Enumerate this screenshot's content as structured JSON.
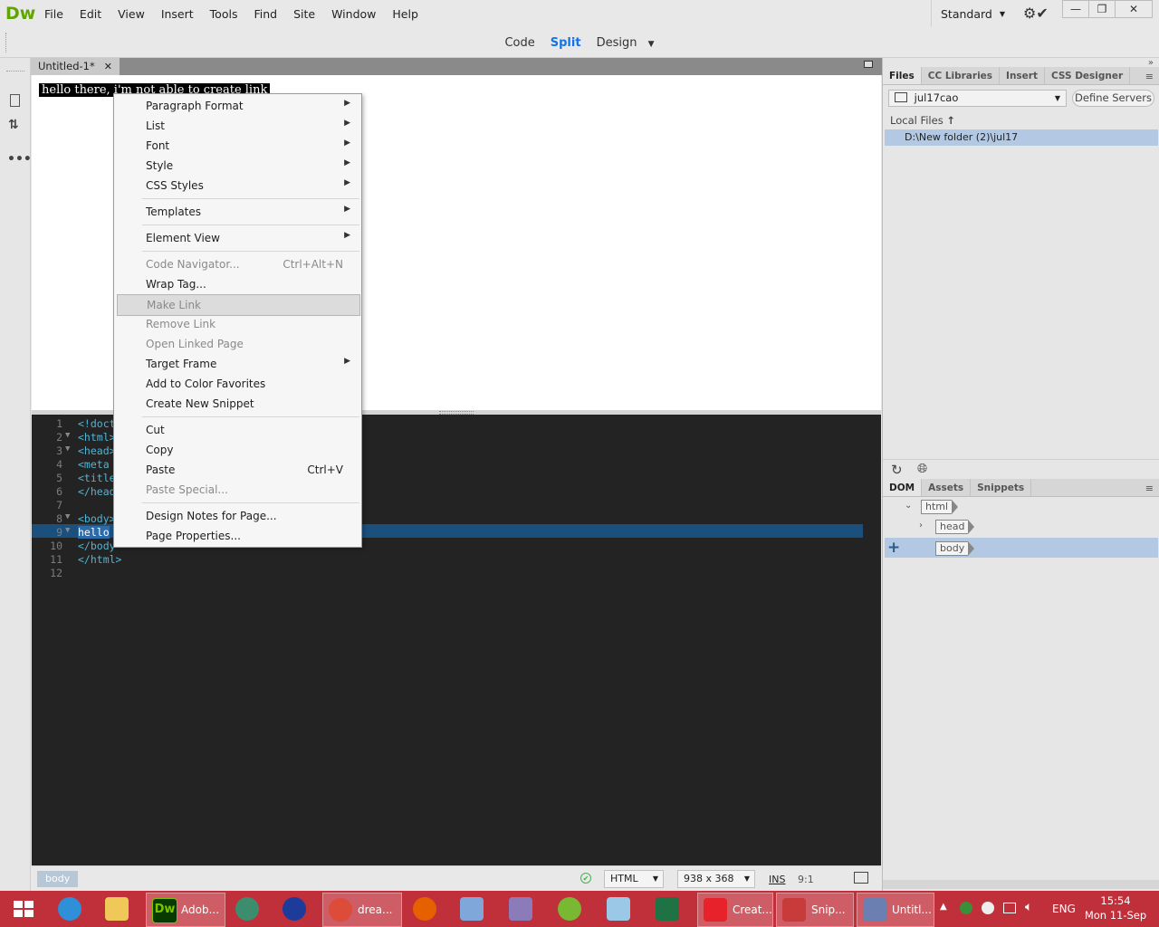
{
  "app": {
    "logo": "Dw"
  },
  "menu": [
    "File",
    "Edit",
    "View",
    "Insert",
    "Tools",
    "Find",
    "Site",
    "Window",
    "Help"
  ],
  "workspace": {
    "label": "Standard"
  },
  "views": {
    "code": "Code",
    "split": "Split",
    "design": "Design"
  },
  "document": {
    "tab_title": "Untitled-1*",
    "selected_text": "hello there, i'm not able to create link"
  },
  "context_menu": {
    "items": [
      {
        "label": "Paragraph Format",
        "submenu": true
      },
      {
        "label": "List",
        "submenu": true
      },
      {
        "label": "Font",
        "submenu": true
      },
      {
        "label": "Style",
        "submenu": true
      },
      {
        "label": "CSS Styles",
        "submenu": true
      },
      {
        "label": "Templates",
        "submenu": true
      },
      {
        "label": "Element View",
        "submenu": true
      },
      {
        "label": "Code Navigator...",
        "shortcut": "Ctrl+Alt+N",
        "disabled": true
      },
      {
        "label": "Wrap Tag..."
      },
      {
        "label": "Make Link",
        "disabled": true,
        "hover": true
      },
      {
        "label": "Remove Link",
        "disabled": true
      },
      {
        "label": "Open Linked Page",
        "disabled": true
      },
      {
        "label": "Target Frame",
        "submenu": true
      },
      {
        "label": "Add to Color Favorites"
      },
      {
        "label": "Create New Snippet"
      },
      {
        "label": "Cut"
      },
      {
        "label": "Copy"
      },
      {
        "label": "Paste",
        "shortcut": "Ctrl+V"
      },
      {
        "label": "Paste Special...",
        "disabled": true
      },
      {
        "label": "Design Notes for Page..."
      },
      {
        "label": "Page Properties..."
      }
    ]
  },
  "code": {
    "lines": [
      {
        "n": "1",
        "text": "<!doct"
      },
      {
        "n": "2",
        "text": "<html>",
        "fold": true
      },
      {
        "n": "3",
        "text": "<head>",
        "fold": true
      },
      {
        "n": "4",
        "text": "<meta"
      },
      {
        "n": "5",
        "text": "<title"
      },
      {
        "n": "6",
        "text": "</head"
      },
      {
        "n": "7",
        "text": ""
      },
      {
        "n": "8",
        "text": "<body>",
        "fold": true
      },
      {
        "n": "9",
        "text": "hello",
        "fold": true
      },
      {
        "n": "10",
        "text": "</body"
      },
      {
        "n": "11",
        "text": "</html>"
      },
      {
        "n": "12",
        "text": ""
      }
    ]
  },
  "status": {
    "tag": "body",
    "doc_type": "HTML",
    "window_size": "938 x 368",
    "mode": "INS",
    "position": "9:1"
  },
  "files_panel": {
    "tabs": [
      "Files",
      "CC Libraries",
      "Insert",
      "CSS Designer"
    ],
    "site": "jul17cao",
    "define_servers": "Define Servers",
    "local_files": "Local Files",
    "path": "D:\\New folder (2)\\jul17"
  },
  "dom_panel": {
    "tabs": [
      "DOM",
      "Assets",
      "Snippets"
    ],
    "nodes": [
      "html",
      "head",
      "body"
    ]
  },
  "taskbar": {
    "items": [
      {
        "label": "Adob...",
        "color": "#3a7d0a"
      },
      {
        "label": "drea...",
        "color": "#dd4b39"
      },
      {
        "label": "Creat...",
        "color": "#e8222b"
      },
      {
        "label": "Snip...",
        "color": "#c73b3b"
      },
      {
        "label": "Untitl...",
        "color": "#6b7fb0"
      }
    ],
    "lang": "ENG",
    "time": "15:54",
    "date": "Mon 11-Sep"
  }
}
